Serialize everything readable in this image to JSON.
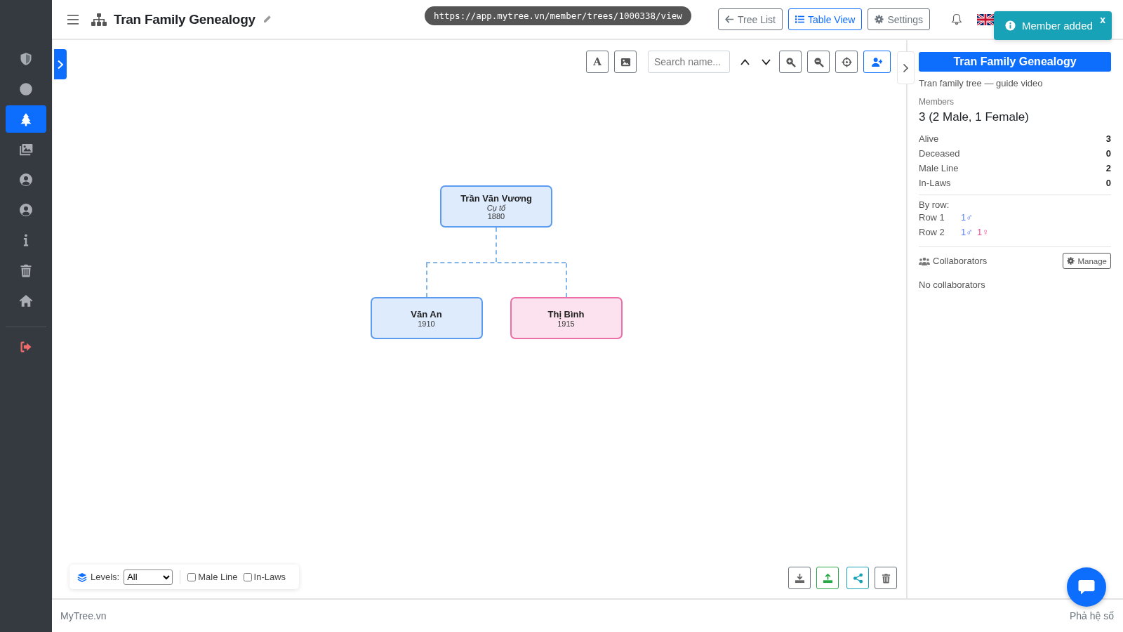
{
  "sidebar": {
    "items": [
      {
        "kind": "shield",
        "selected": false
      },
      {
        "kind": "circle",
        "selected": false
      },
      {
        "kind": "tree",
        "selected": true
      },
      {
        "kind": "images",
        "selected": false
      },
      {
        "kind": "user",
        "selected": false
      },
      {
        "kind": "user",
        "selected": false
      },
      {
        "kind": "info",
        "selected": false
      },
      {
        "kind": "trash",
        "selected": false
      },
      {
        "kind": "home",
        "selected": false
      }
    ],
    "bottom_items": [
      {
        "kind": "logout",
        "selected": false
      }
    ]
  },
  "header": {
    "title": "Tran Family Genealogy",
    "buttons": [
      {
        "kind": "back",
        "label": "Tree List"
      },
      {
        "kind": "table",
        "label": "Table View"
      },
      {
        "kind": "settings",
        "label": "Settings"
      }
    ]
  },
  "url_tooltip": "https://app.mytree.vn/member/trees/1000338/view",
  "toast": {
    "message": "Member added",
    "close": "x"
  },
  "toolbar": {
    "search": {
      "placeholder": "Search name..."
    },
    "tools": [
      {
        "kind": "font",
        "label": "A"
      },
      {
        "kind": "image"
      },
      {
        "kind": "search"
      },
      {
        "kind": "up"
      },
      {
        "kind": "down"
      },
      {
        "kind": "zoom-in"
      },
      {
        "kind": "zoom-out"
      },
      {
        "kind": "center"
      },
      {
        "kind": "add-member"
      }
    ]
  },
  "tree": {
    "root": {
      "name": "Trần Văn Vương",
      "title": "Cụ tổ",
      "year": "1880",
      "color": "#5b9bf0",
      "children": [
        {
          "name": "Văn An",
          "year": "1910",
          "color": "#5b9bf0"
        },
        {
          "name": "Thị Bình",
          "year": "1915",
          "color": "#ec6fa8"
        }
      ]
    }
  },
  "filters": {
    "levels_label": "Levels:",
    "levels_value": "All",
    "checkboxes": [
      {
        "label": "Male Line",
        "checked": false
      },
      {
        "label": "In-Laws",
        "checked": false
      }
    ]
  },
  "actions": [
    {
      "kind": "download"
    },
    {
      "kind": "upload"
    },
    {
      "kind": "share"
    },
    {
      "kind": "delete"
    }
  ],
  "panel": {
    "title": "Tran Family Genealogy",
    "subtitle": "Tran family tree — guide video",
    "members_label": "Members",
    "members_value": "3 (2 Male, 1 Female)",
    "stats": [
      {
        "label": "Alive",
        "value": "3"
      },
      {
        "label": "Deceased",
        "value": "0"
      },
      {
        "label": "Male Line",
        "value": "2"
      },
      {
        "label": "In-Laws",
        "value": "0"
      }
    ],
    "by_row_label": "By row:",
    "rows": [
      {
        "label": "Row 1",
        "counts": [
          {
            "text": "1♂",
            "color": "#5b7ff0"
          }
        ]
      },
      {
        "label": "Row 2",
        "counts": [
          {
            "text": "1♂",
            "color": "#5b7ff0"
          },
          {
            "text": "1♀",
            "color": "#ec4f95"
          }
        ]
      }
    ],
    "collaborators": {
      "label": "Collaborators",
      "button": "Manage",
      "empty": "No collaborators"
    }
  },
  "footer": {
    "left": "MyTree.vn",
    "right": "Phả hệ số"
  }
}
